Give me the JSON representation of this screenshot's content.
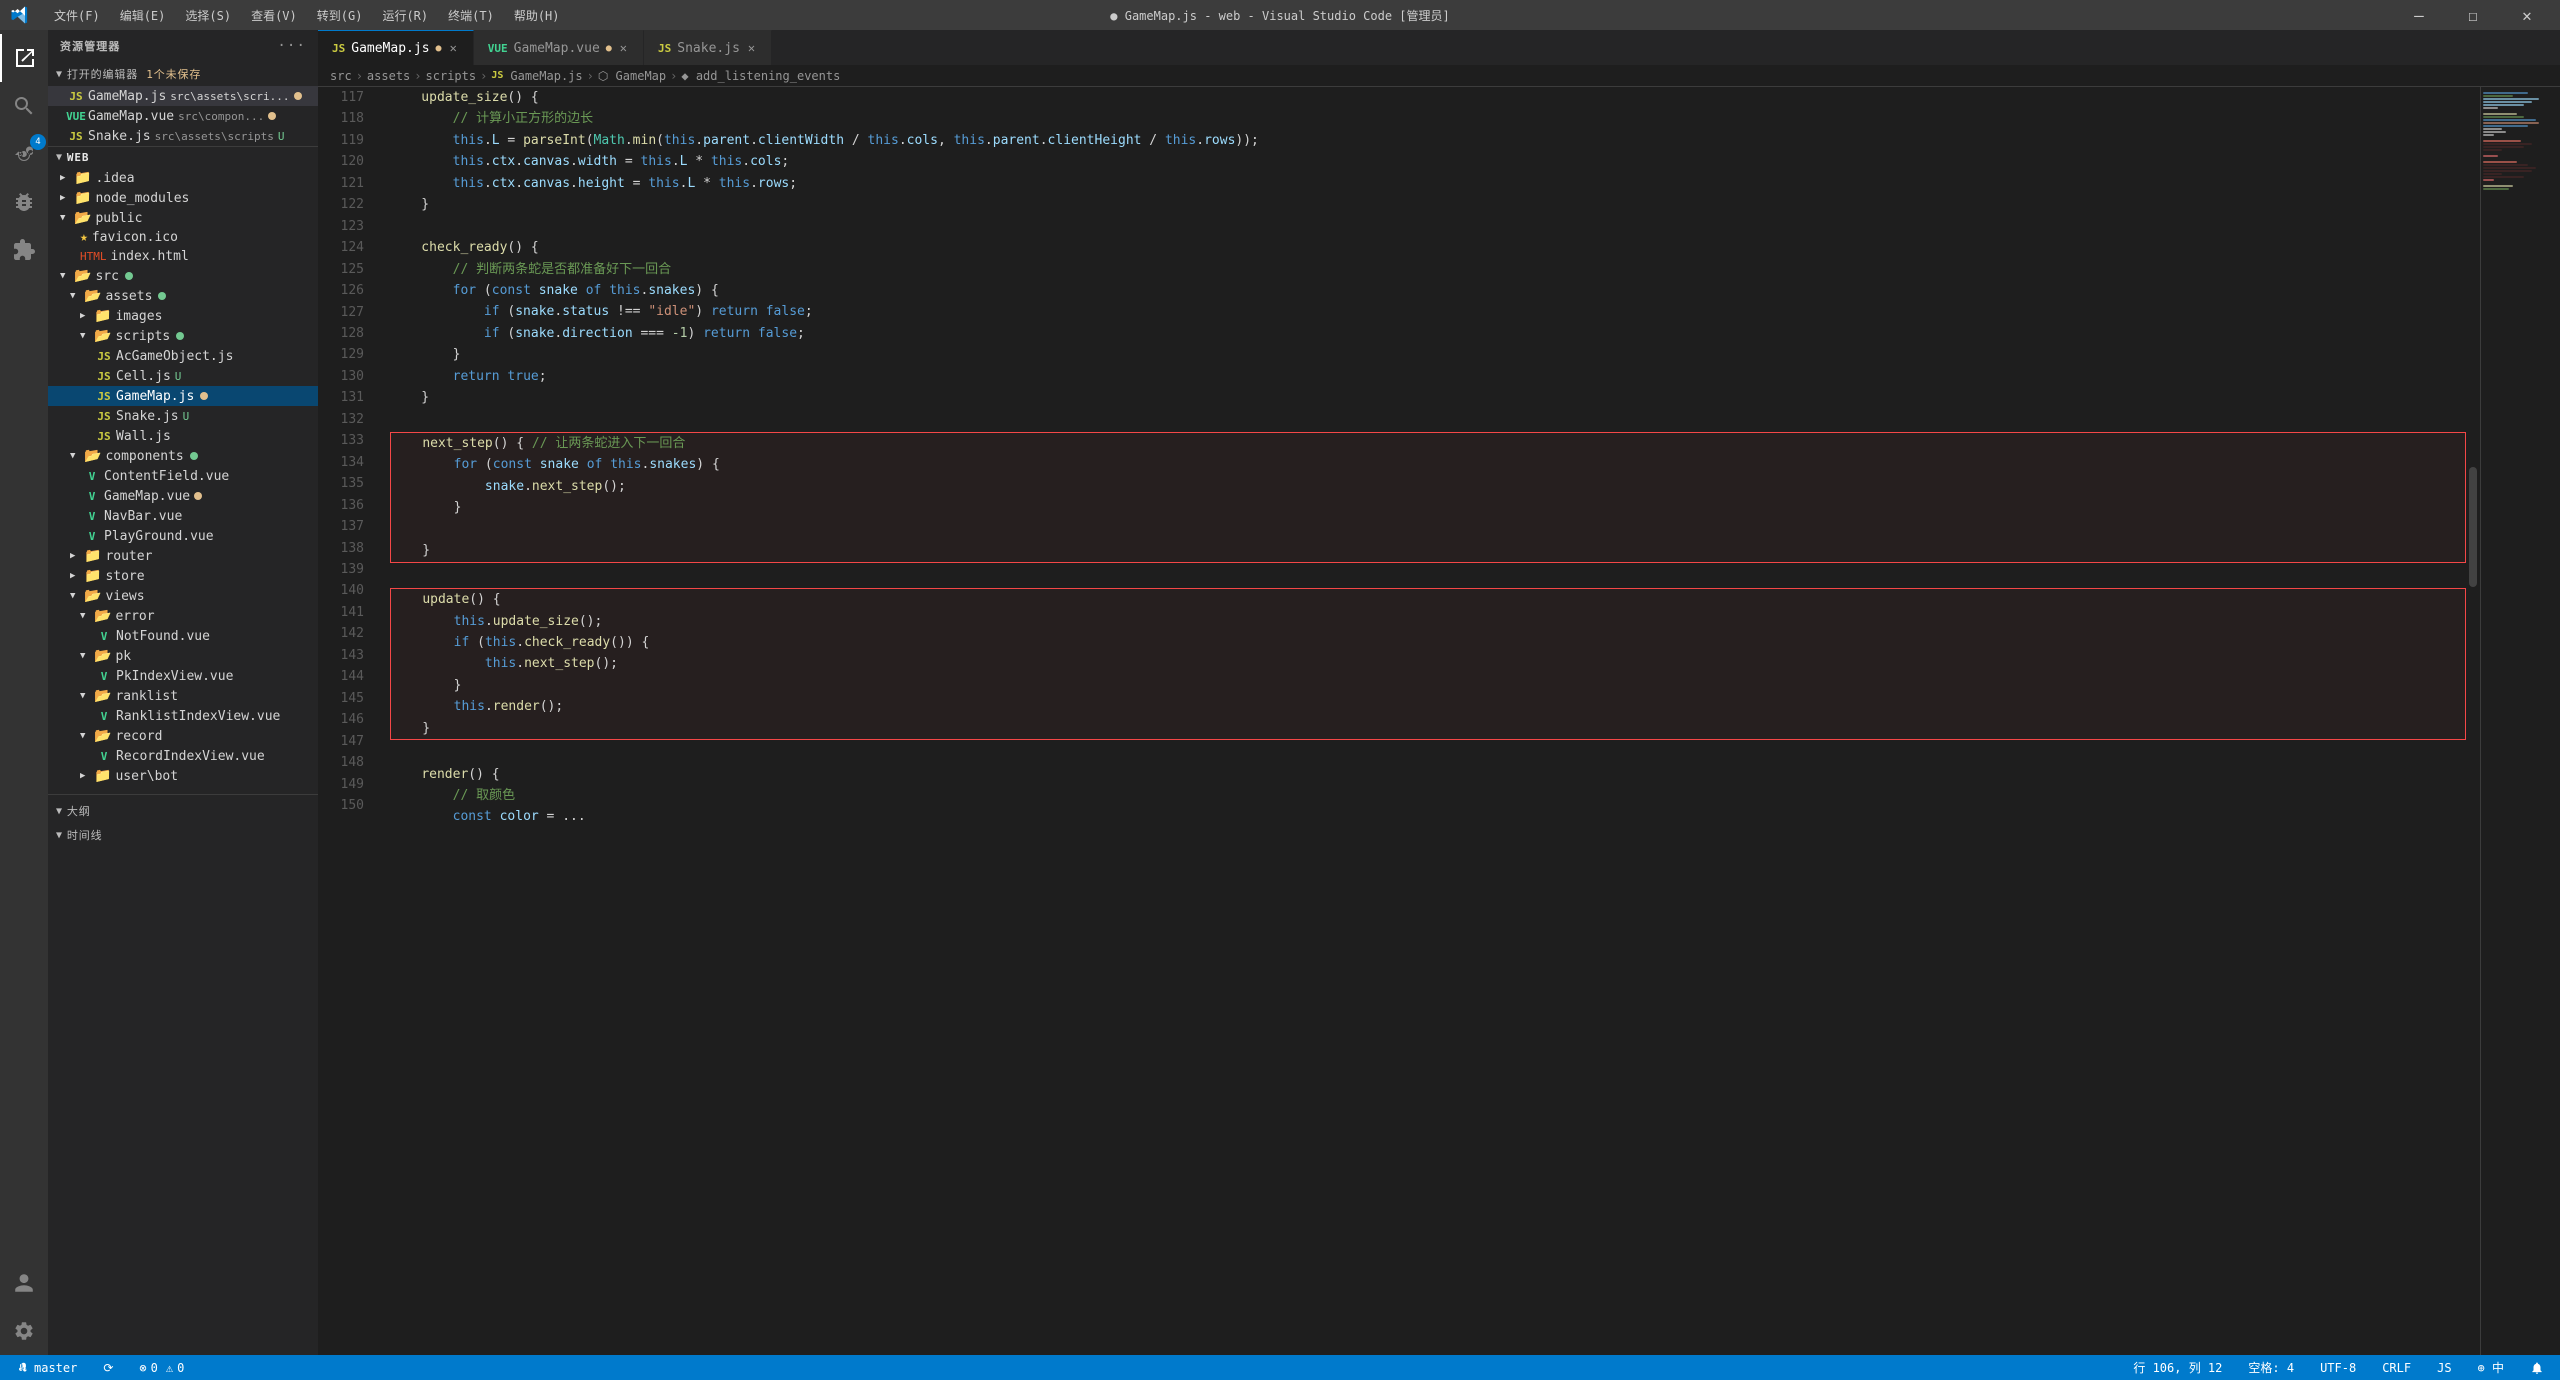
{
  "titlebar": {
    "title": "● GameMap.js - web - Visual Studio Code [管理员]",
    "menu": [
      "文件(F)",
      "编辑(E)",
      "选择(S)",
      "查看(V)",
      "转到(G)",
      "运行(R)",
      "终端(T)",
      "帮助(H)"
    ]
  },
  "tabs": [
    {
      "id": "gamemap-js",
      "label": "GameMap.js",
      "lang": "JS",
      "dirty": true,
      "active": true
    },
    {
      "id": "gamemap-vue",
      "label": "GameMap.vue",
      "lang": "VUE",
      "dirty": true,
      "active": false
    },
    {
      "id": "snake-js",
      "label": "Snake.js",
      "lang": "JS",
      "dirty": false,
      "active": false
    }
  ],
  "breadcrumb": [
    "src",
    ">",
    "assets",
    ">",
    "scripts",
    ">",
    "JS GameMap.js",
    ">",
    "⬡ GameMap",
    ">",
    "◆ add_listening_events"
  ],
  "sidebar": {
    "header": "资源管理器",
    "opened_editors": {
      "label": "打开的编辑器",
      "badge": "1个未保存",
      "files": [
        {
          "name": "GameMap.js",
          "path": "src\\assets\\scri...",
          "lang": "JS",
          "badge": "M",
          "active": true
        },
        {
          "name": "GameMap.vue",
          "path": "src\\compon...",
          "lang": "VUE",
          "badge": "M"
        },
        {
          "name": "Snake.js",
          "path": "src\\assets\\scripts",
          "lang": "JS",
          "badge": "U"
        }
      ]
    },
    "tree": {
      "root": "WEB",
      "items": [
        {
          "label": ".idea",
          "type": "folder",
          "depth": 1,
          "collapsed": true
        },
        {
          "label": "node_modules",
          "type": "folder",
          "depth": 1,
          "collapsed": true
        },
        {
          "label": "public",
          "type": "folder",
          "depth": 1,
          "expanded": true
        },
        {
          "label": "favicon.ico",
          "type": "file",
          "depth": 2,
          "icon": "★"
        },
        {
          "label": "index.html",
          "type": "file",
          "depth": 2
        },
        {
          "label": "src",
          "type": "folder",
          "depth": 1,
          "expanded": true,
          "dot": "green"
        },
        {
          "label": "assets",
          "type": "folder",
          "depth": 2,
          "expanded": true,
          "dot": "green"
        },
        {
          "label": "images",
          "type": "folder",
          "depth": 3,
          "collapsed": true
        },
        {
          "label": "scripts",
          "type": "folder",
          "depth": 3,
          "expanded": true,
          "dot": "green"
        },
        {
          "label": "AcGameObject.js",
          "type": "file",
          "depth": 4,
          "lang": "JS"
        },
        {
          "label": "Cell.js",
          "type": "file",
          "depth": 4,
          "lang": "JS",
          "badge": "U"
        },
        {
          "label": "GameMap.js",
          "type": "file",
          "depth": 4,
          "lang": "JS",
          "active": true
        },
        {
          "label": "Snake.js",
          "type": "file",
          "depth": 4,
          "lang": "JS",
          "badge": "U"
        },
        {
          "label": "Wall.js",
          "type": "file",
          "depth": 4,
          "lang": "JS"
        },
        {
          "label": "components",
          "type": "folder",
          "depth": 2,
          "expanded": true,
          "dot": "green"
        },
        {
          "label": "ContentField.vue",
          "type": "file",
          "depth": 3,
          "lang": "VUE"
        },
        {
          "label": "GameMap.vue",
          "type": "file",
          "depth": 3,
          "lang": "VUE",
          "badge": "M"
        },
        {
          "label": "NavBar.vue",
          "type": "file",
          "depth": 3,
          "lang": "VUE"
        },
        {
          "label": "PlayGround.vue",
          "type": "file",
          "depth": 3,
          "lang": "VUE"
        },
        {
          "label": "router",
          "type": "folder",
          "depth": 2,
          "collapsed": true
        },
        {
          "label": "store",
          "type": "folder",
          "depth": 2,
          "collapsed": true
        },
        {
          "label": "views",
          "type": "folder",
          "depth": 2,
          "expanded": true
        },
        {
          "label": "error",
          "type": "folder",
          "depth": 3,
          "expanded": true
        },
        {
          "label": "NotFound.vue",
          "type": "file",
          "depth": 4,
          "lang": "VUE"
        },
        {
          "label": "pk",
          "type": "folder",
          "depth": 3,
          "expanded": true
        },
        {
          "label": "PkIndexView.vue",
          "type": "file",
          "depth": 4,
          "lang": "VUE"
        },
        {
          "label": "ranklist",
          "type": "folder",
          "depth": 3,
          "expanded": true
        },
        {
          "label": "RanklistIndexView.vue",
          "type": "file",
          "depth": 4,
          "lang": "VUE"
        },
        {
          "label": "record",
          "type": "folder",
          "depth": 3,
          "expanded": true
        },
        {
          "label": "RecordIndexView.vue",
          "type": "file",
          "depth": 4,
          "lang": "VUE"
        },
        {
          "label": "user\\bot",
          "type": "folder",
          "depth": 3,
          "collapsed": true
        }
      ]
    }
  },
  "code": {
    "lines": [
      {
        "num": "117",
        "content": "    update_size() {",
        "indent": 4
      },
      {
        "num": "118",
        "content": "        // 计算小正方形的边长",
        "type": "comment"
      },
      {
        "num": "119",
        "content": "        this.L = parseInt(Math.min(this.parent.clientWidth / this.cols, this.parent.clientHeight / this.rows));"
      },
      {
        "num": "120",
        "content": "        this.ctx.canvas.width = this.L * this.cols;"
      },
      {
        "num": "121",
        "content": "        this.ctx.canvas.height = this.L * this.rows;"
      },
      {
        "num": "122",
        "content": "    }"
      },
      {
        "num": "123",
        "content": ""
      },
      {
        "num": "124",
        "content": "    check_ready() {"
      },
      {
        "num": "125",
        "content": "        // 判断两条蛇是否都准备好下一回合",
        "type": "comment"
      },
      {
        "num": "126",
        "content": "        for (const snake of this.snakes) {"
      },
      {
        "num": "127",
        "content": "            if (snake.status !== \"idle\") return false;"
      },
      {
        "num": "128",
        "content": "            if (snake.direction === -1) return false;"
      },
      {
        "num": "129",
        "content": "        }"
      },
      {
        "num": "130",
        "content": "        return true;"
      },
      {
        "num": "131",
        "content": "    }"
      },
      {
        "num": "132",
        "content": ""
      },
      {
        "num": "133",
        "content": "    next_step() { // 让两条蛇进入下一回合",
        "highlight_start": true
      },
      {
        "num": "134",
        "content": "        for (const snake of this.snakes) {"
      },
      {
        "num": "135",
        "content": "            snake.next_step();"
      },
      {
        "num": "136",
        "content": "        }"
      },
      {
        "num": "137",
        "content": ""
      },
      {
        "num": "138",
        "content": "    }",
        "highlight_end": true
      },
      {
        "num": "139",
        "content": ""
      },
      {
        "num": "140",
        "content": "    update() {",
        "highlight_start": true
      },
      {
        "num": "141",
        "content": "        this.update_size();"
      },
      {
        "num": "142",
        "content": "        if (this.check_ready()) {"
      },
      {
        "num": "143",
        "content": "            this.next_step();"
      },
      {
        "num": "144",
        "content": "        }"
      },
      {
        "num": "145",
        "content": "        this.render();"
      },
      {
        "num": "146",
        "content": "    }",
        "highlight_end": true
      },
      {
        "num": "147",
        "content": ""
      },
      {
        "num": "148",
        "content": "    render() {"
      },
      {
        "num": "149",
        "content": "        // 取颜色",
        "type": "comment"
      },
      {
        "num": "150",
        "content": "        const color = ..."
      }
    ]
  },
  "statusbar": {
    "left": {
      "branch": "master",
      "sync": "⟳",
      "errors": "⊗ 0",
      "warnings": "⚠ 0"
    },
    "right": {
      "cursor": "行 106, 列 12",
      "spaces": "空格: 4",
      "encoding": "UTF-8",
      "eol": "CRLF",
      "language": "JS",
      "feedback": "⊕ 中",
      "notifications": "🔔"
    }
  }
}
